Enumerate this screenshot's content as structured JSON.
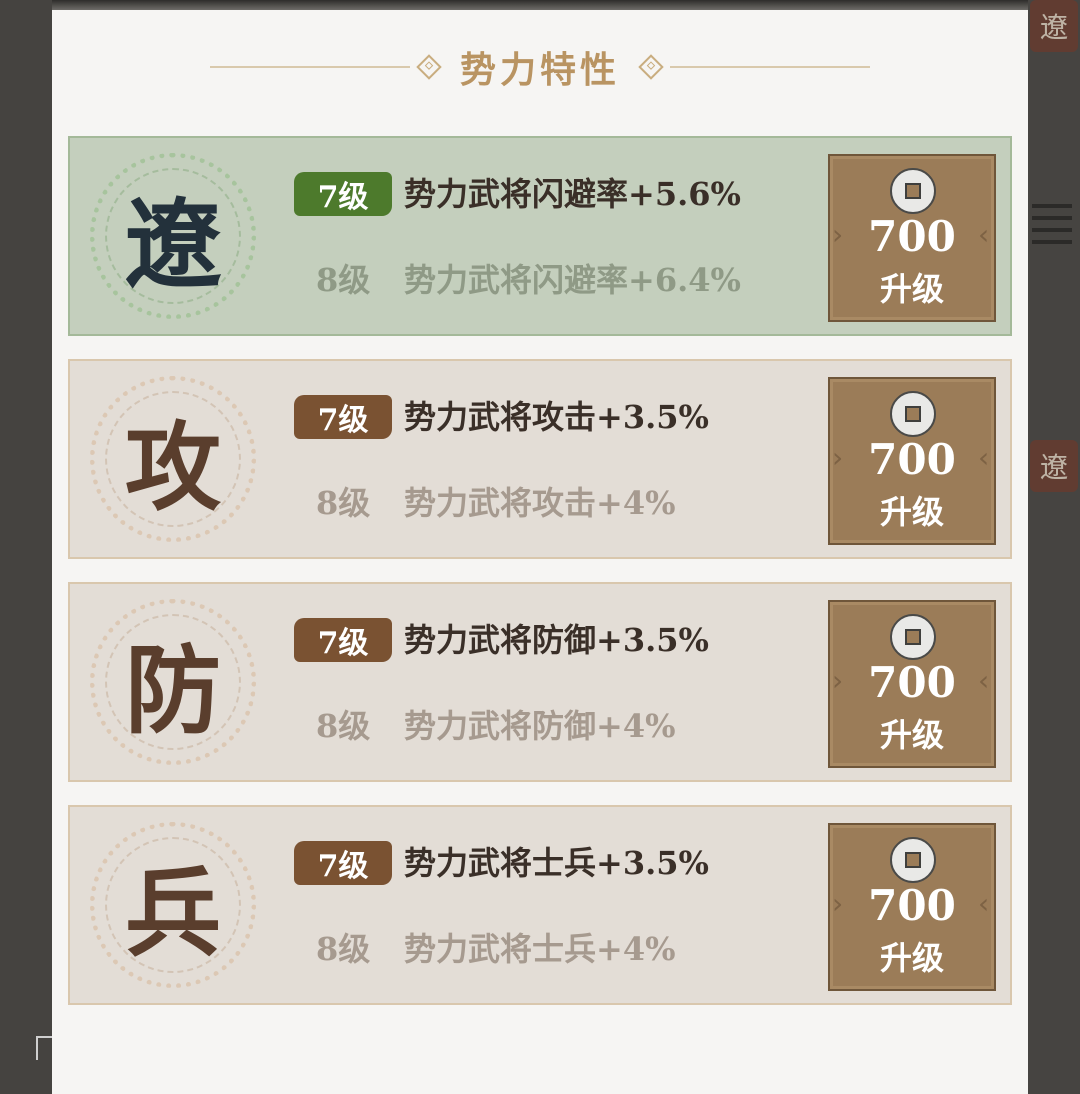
{
  "panel": {
    "title": "势力特性"
  },
  "background": {
    "seal_char_1": "遼",
    "seal_char_2": "遼"
  },
  "traits": [
    {
      "emblem": "遼",
      "current_level": "7级",
      "current_effect": "势力武将闪避率+5.6%",
      "next_level": "8级",
      "next_effect": "势力武将闪避率+6.4%",
      "cost": "700",
      "button_label": "升级",
      "active": true
    },
    {
      "emblem": "攻",
      "current_level": "7级",
      "current_effect": "势力武将攻击+3.5%",
      "next_level": "8级",
      "next_effect": "势力武将攻击+4%",
      "cost": "700",
      "button_label": "升级",
      "active": false
    },
    {
      "emblem": "防",
      "current_level": "7级",
      "current_effect": "势力武将防御+3.5%",
      "next_level": "8级",
      "next_effect": "势力武将防御+4%",
      "cost": "700",
      "button_label": "升级",
      "active": false
    },
    {
      "emblem": "兵",
      "current_level": "7级",
      "current_effect": "势力武将士兵+3.5%",
      "next_level": "8级",
      "next_effect": "势力武将士兵+4%",
      "cost": "700",
      "button_label": "升级",
      "active": false
    }
  ],
  "icons": {
    "currency": "copper-coin-icon"
  },
  "colors": {
    "active_badge": "#4d7a2c",
    "badge": "#7a5232",
    "button": "#9b7c58",
    "title": "#b99462"
  }
}
